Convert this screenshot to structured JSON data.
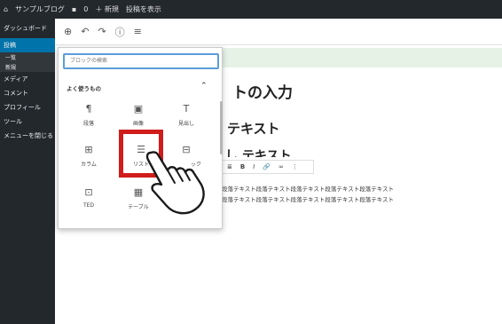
{
  "adminbar": {
    "site_name": "サンプルブログ",
    "comments_count": "0",
    "new_label": "＋ 新規",
    "view_post_label": "投稿を表示"
  },
  "sidebar": {
    "items": [
      {
        "label": "ダッシュボード"
      },
      {
        "label": "投稿"
      },
      {
        "label": "一覧"
      },
      {
        "label": "新規"
      },
      {
        "label": "メディア"
      },
      {
        "label": "コメント"
      },
      {
        "label": "プロフィール"
      },
      {
        "label": "ツール"
      },
      {
        "label": "メニューを閉じる"
      }
    ]
  },
  "toolbar": {
    "add_icon": "plus-circle-icon",
    "undo_icon": "undo-icon",
    "redo_icon": "redo-icon",
    "info_icon": "info-icon",
    "outline_icon": "list-outline-icon"
  },
  "editor": {
    "title": "トの入力",
    "heading": "テキスト",
    "heading2": "し テキスト",
    "paragraph_line1": "段落テキスト段落テキスト段落テキスト段落テキスト段落テキスト",
    "paragraph_line2": "段落テキスト段落テキスト段落テキスト段落テキスト段落テキスト"
  },
  "block_toolbar": {
    "items": [
      "≣",
      "B",
      "I",
      "🔗",
      "∞",
      "⋮"
    ]
  },
  "inserter": {
    "search_placeholder": "ブロックの検索",
    "panel_title": "よく使うもの",
    "chevron": "⌃",
    "blocks": [
      {
        "icon": "¶",
        "label": "段落"
      },
      {
        "icon": "▣",
        "label": "画像"
      },
      {
        "icon": "T",
        "label": "見出し"
      },
      {
        "icon": "⊞",
        "label": "カラム"
      },
      {
        "icon": "☰",
        "label": "リスト"
      },
      {
        "icon": "⊟",
        "label": "ック"
      },
      {
        "icon": "⊡",
        "label": "TED"
      },
      {
        "icon": "▦",
        "label": "テーブル"
      }
    ]
  },
  "colors": {
    "admin_bg": "#23282d",
    "accent": "#0073aa",
    "highlight": "#d11c1c"
  }
}
